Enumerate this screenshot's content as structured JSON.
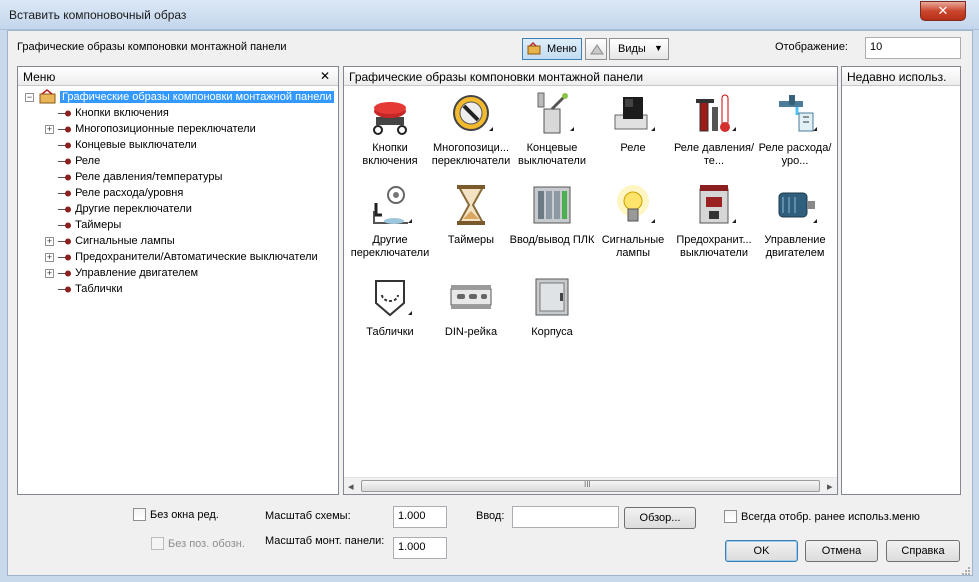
{
  "window": {
    "title": "Вставить компоновочный образ",
    "close_glyph": "✕"
  },
  "toolbar": {
    "section_label": "Графические образы компоновки монтажной панели",
    "menu_button": "Меню",
    "views_button": "Виды",
    "views_arrow": "▼",
    "display_label": "Отображение:",
    "display_value": "10"
  },
  "menu_panel": {
    "header": "Меню",
    "close_glyph": "✕",
    "tree": {
      "root": "Графические образы компоновки монтажной панели",
      "items": [
        {
          "label": "Кнопки включения",
          "expandable": false
        },
        {
          "label": "Многопозиционные переключатели",
          "expandable": true
        },
        {
          "label": "Концевые выключатели",
          "expandable": false
        },
        {
          "label": "Реле",
          "expandable": false
        },
        {
          "label": "Реле давления/температуры",
          "expandable": false
        },
        {
          "label": "Реле расхода/уровня",
          "expandable": false
        },
        {
          "label": "Другие переключатели",
          "expandable": false
        },
        {
          "label": "Таймеры",
          "expandable": false
        },
        {
          "label": "Сигнальные лампы",
          "expandable": true
        },
        {
          "label": "Предохранители/Автоматические выключатели",
          "expandable": true
        },
        {
          "label": "Управление двигателем",
          "expandable": true
        },
        {
          "label": "Таблички",
          "expandable": false
        }
      ]
    }
  },
  "gallery": {
    "header": "Графические образы компоновки монтажной панели",
    "tiles": [
      {
        "label": "Кнопки включения",
        "icon": "push-button-icon",
        "more": false
      },
      {
        "label": "Многопозици... переключатели",
        "icon": "selector-switch-icon",
        "more": true
      },
      {
        "label": "Концевые выключатели",
        "icon": "limit-switch-icon",
        "more": true
      },
      {
        "label": "Реле",
        "icon": "relay-icon",
        "more": true
      },
      {
        "label": "Реле давления/те...",
        "icon": "pressure-temp-relay-icon",
        "more": true
      },
      {
        "label": "Реле расхода/уро...",
        "icon": "flow-level-relay-icon",
        "more": true
      },
      {
        "label": "Другие переключатели",
        "icon": "other-switch-icon",
        "more": true
      },
      {
        "label": "Таймеры",
        "icon": "timer-icon",
        "more": false
      },
      {
        "label": "Ввод/вывод ПЛК",
        "icon": "plc-io-icon",
        "more": false
      },
      {
        "label": "Сигнальные лампы",
        "icon": "pilot-lamp-icon",
        "more": true
      },
      {
        "label": "Предохранит... выключатели",
        "icon": "fuse-breaker-icon",
        "more": true
      },
      {
        "label": "Управление двигателем",
        "icon": "motor-control-icon",
        "more": true
      },
      {
        "label": "Таблички",
        "icon": "nameplate-icon",
        "more": true
      },
      {
        "label": "DIN-рейка",
        "icon": "din-rail-icon",
        "more": false
      },
      {
        "label": "Корпуса",
        "icon": "enclosure-icon",
        "more": false
      }
    ],
    "scroll_left": "◂",
    "scroll_right": "▸",
    "scroll_thumb_grip": "III"
  },
  "recent_panel": {
    "header": "Недавно использ."
  },
  "bottom": {
    "no_edit_window": "Без окна ред.",
    "no_pos_designation": "Без поз. обозн.",
    "scheme_scale_label": "Масштаб схемы:",
    "scheme_scale_value": "1.000",
    "panel_scale_label": "Масштаб монт. панели:",
    "panel_scale_value": "1.000",
    "input_label": "Ввод:",
    "input_value": "",
    "browse_button": "Обзор...",
    "always_show_recent": "Всегда отобр. ранее использ.меню",
    "ok_button": "OK",
    "cancel_button": "Отмена",
    "help_button": "Справка"
  },
  "colors": {
    "selection": "#3399ff",
    "window_frame": "#c9d9ec",
    "close_red": "#c9462c"
  }
}
